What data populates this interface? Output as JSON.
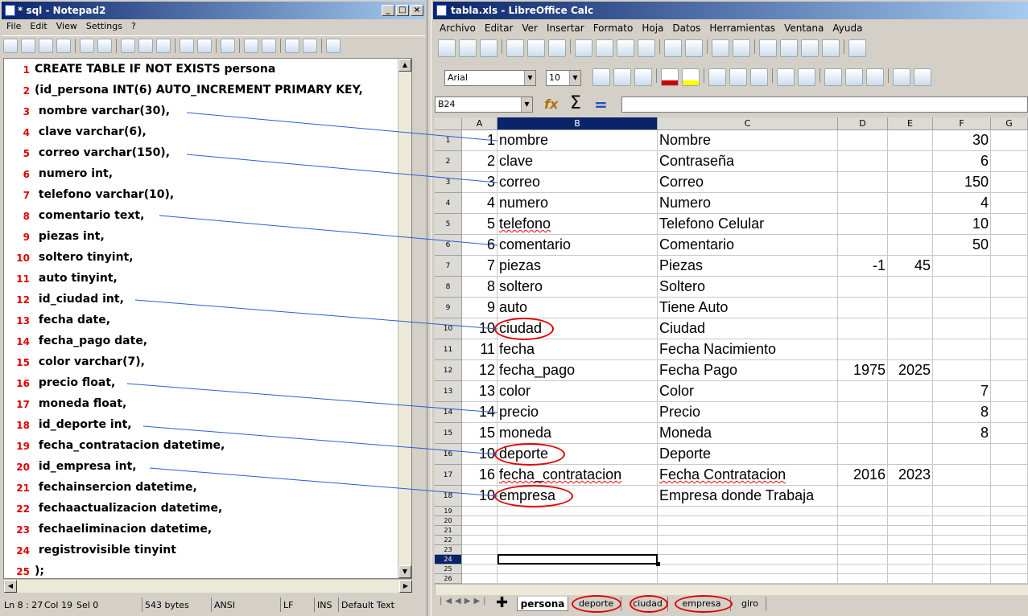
{
  "notepad": {
    "title": "* sql - Notepad2",
    "menu": [
      "File",
      "Edit",
      "View",
      "Settings",
      "?"
    ],
    "lines": [
      "CREATE TABLE IF NOT EXISTS persona",
      "(id_persona INT(6) AUTO_INCREMENT PRIMARY KEY,",
      " nombre varchar(30),",
      " clave varchar(6),",
      " correo varchar(150),",
      " numero int,",
      " telefono varchar(10),",
      " comentario text,",
      " piezas int,",
      " soltero tinyint,",
      " auto tinyint,",
      " id_ciudad int,",
      " fecha date,",
      " fecha_pago date,",
      " color varchar(7),",
      " precio float,",
      " moneda float,",
      " id_deporte int,",
      " fecha_contratacion datetime,",
      " id_empresa int,",
      " fechainsercion datetime,",
      " fechaactualizacion datetime,",
      " fechaeliminacion datetime,",
      " registrovisible tinyint",
      ");"
    ],
    "line_numbers": [
      "1",
      "2",
      "3",
      "4",
      "5",
      "6",
      "7",
      "8",
      "9",
      "10",
      "11",
      "12",
      "13",
      "14",
      "15",
      "16",
      "17",
      "18",
      "19",
      "20",
      "21",
      "22",
      "23",
      "24",
      "25"
    ],
    "status": {
      "pos": "Ln 8 : 27",
      "col": "Col 19",
      "sel": "Sel 0",
      "size": "543 bytes",
      "encoding": "ANSI",
      "eol": "LF",
      "mode": "INS",
      "scheme": "Default Text"
    }
  },
  "calc": {
    "title": "tabla.xls - LibreOffice Calc",
    "menu": [
      "Archivo",
      "Editar",
      "Ver",
      "Insertar",
      "Formato",
      "Hoja",
      "Datos",
      "Herramientas",
      "Ventana",
      "Ayuda"
    ],
    "font_name": "Arial",
    "font_size": "10",
    "name_box": "B24",
    "columns": [
      "A",
      "B",
      "C",
      "D",
      "E",
      "F",
      "G"
    ],
    "rows": [
      {
        "n": "1",
        "a": "1",
        "b": "nombre",
        "c": "Nombre",
        "d": "",
        "e": "",
        "f": "30"
      },
      {
        "n": "2",
        "a": "2",
        "b": "clave",
        "c": "Contraseña",
        "d": "",
        "e": "",
        "f": "6"
      },
      {
        "n": "3",
        "a": "3",
        "b": "correo",
        "c": "Correo",
        "d": "",
        "e": "",
        "f": "150"
      },
      {
        "n": "4",
        "a": "4",
        "b": "numero",
        "c": "Numero",
        "d": "",
        "e": "",
        "f": "4"
      },
      {
        "n": "5",
        "a": "5",
        "b": "telefono",
        "c": "Telefono Celular",
        "d": "",
        "e": "",
        "f": "10"
      },
      {
        "n": "6",
        "a": "6",
        "b": "comentario",
        "c": "Comentario",
        "d": "",
        "e": "",
        "f": "50"
      },
      {
        "n": "7",
        "a": "7",
        "b": "piezas",
        "c": "Piezas",
        "d": "-1",
        "e": "45",
        "f": ""
      },
      {
        "n": "8",
        "a": "8",
        "b": "soltero",
        "c": "Soltero",
        "d": "",
        "e": "",
        "f": ""
      },
      {
        "n": "9",
        "a": "9",
        "b": "auto",
        "c": "Tiene Auto",
        "d": "",
        "e": "",
        "f": ""
      },
      {
        "n": "10",
        "a": "10",
        "b": "ciudad",
        "c": "Ciudad",
        "d": "",
        "e": "",
        "f": ""
      },
      {
        "n": "11",
        "a": "11",
        "b": "fecha",
        "c": "Fecha Nacimiento",
        "d": "",
        "e": "",
        "f": ""
      },
      {
        "n": "12",
        "a": "12",
        "b": "fecha_pago",
        "c": "Fecha Pago",
        "d": "1975",
        "e": "2025",
        "f": ""
      },
      {
        "n": "13",
        "a": "13",
        "b": "color",
        "c": "Color",
        "d": "",
        "e": "",
        "f": "7"
      },
      {
        "n": "14",
        "a": "14",
        "b": "precio",
        "c": "Precio",
        "d": "",
        "e": "",
        "f": "8"
      },
      {
        "n": "15",
        "a": "15",
        "b": "moneda",
        "c": "Moneda",
        "d": "",
        "e": "",
        "f": "8"
      },
      {
        "n": "16",
        "a": "10",
        "b": "deporte",
        "c": "Deporte",
        "d": "",
        "e": "",
        "f": ""
      },
      {
        "n": "17",
        "a": "16",
        "b": "fecha_contratacion",
        "c": "Fecha Contratacion",
        "d": "2016",
        "e": "2023",
        "f": ""
      },
      {
        "n": "18",
        "a": "10",
        "b": "empresa",
        "c": "Empresa donde Trabaja",
        "d": "",
        "e": "",
        "f": ""
      }
    ],
    "small_rows": [
      "19",
      "20",
      "21",
      "22",
      "23",
      "24",
      "25",
      "26"
    ],
    "sheet_tabs": [
      "persona",
      "deporte",
      "ciudad",
      "empresa",
      "giro"
    ],
    "active_sheet": "persona"
  }
}
